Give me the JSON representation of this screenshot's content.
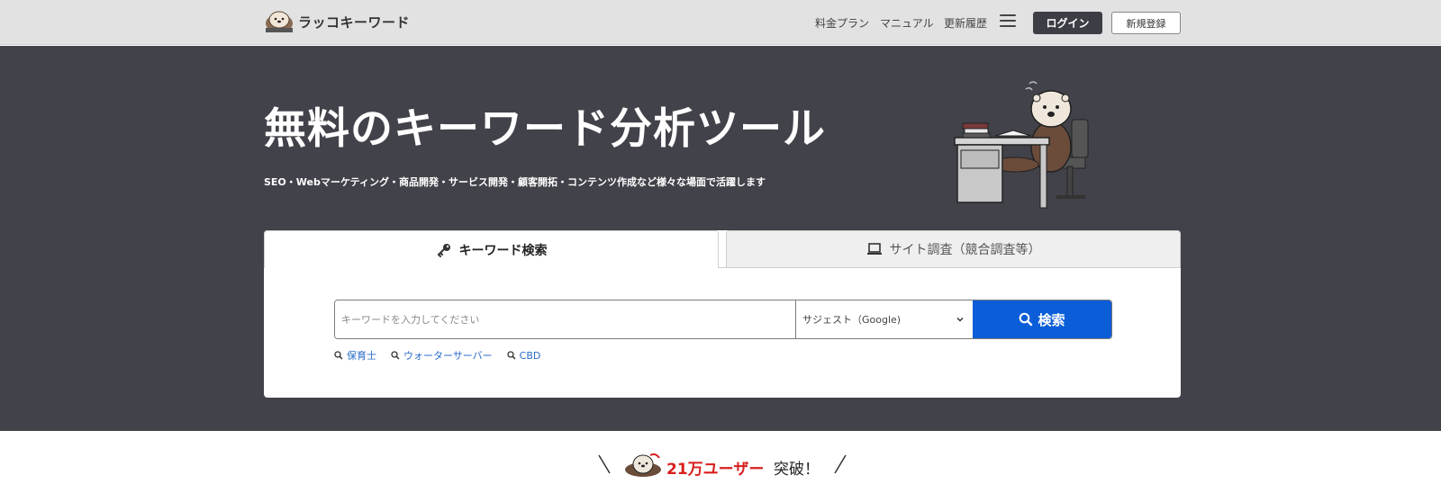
{
  "header": {
    "logo_text": "ラッコキーワード",
    "nav": [
      {
        "label": "料金プラン"
      },
      {
        "label": "マニュアル"
      },
      {
        "label": "更新履歴"
      }
    ],
    "login_label": "ログイン",
    "signup_label": "新規登録"
  },
  "hero": {
    "title": "無料のキーワード分析ツール",
    "subtitle": "SEO・Webマーケティング・商品開発・サービス開発・顧客開拓・コンテンツ作成など様々な場面で活躍します"
  },
  "search_panel": {
    "tabs": [
      {
        "label": "キーワード検索",
        "icon": "key-icon",
        "active": true
      },
      {
        "label": "サイト調査（競合調査等）",
        "icon": "laptop-icon",
        "active": false
      }
    ],
    "input_placeholder": "キーワードを入力してください",
    "input_value": "",
    "select_value": "サジェスト（Google)",
    "search_button_label": "検索",
    "suggestions": [
      {
        "label": "保育士"
      },
      {
        "label": "ウォーターサーバー"
      },
      {
        "label": "CBD"
      }
    ]
  },
  "banner": {
    "count_text": "21万ユーザー",
    "suffix_text": "突破！"
  },
  "colors": {
    "hero_bg": "#42424a",
    "primary_blue": "#0b5ed7",
    "login_bg": "#3d3d45",
    "accent_red": "#d81e1e"
  }
}
